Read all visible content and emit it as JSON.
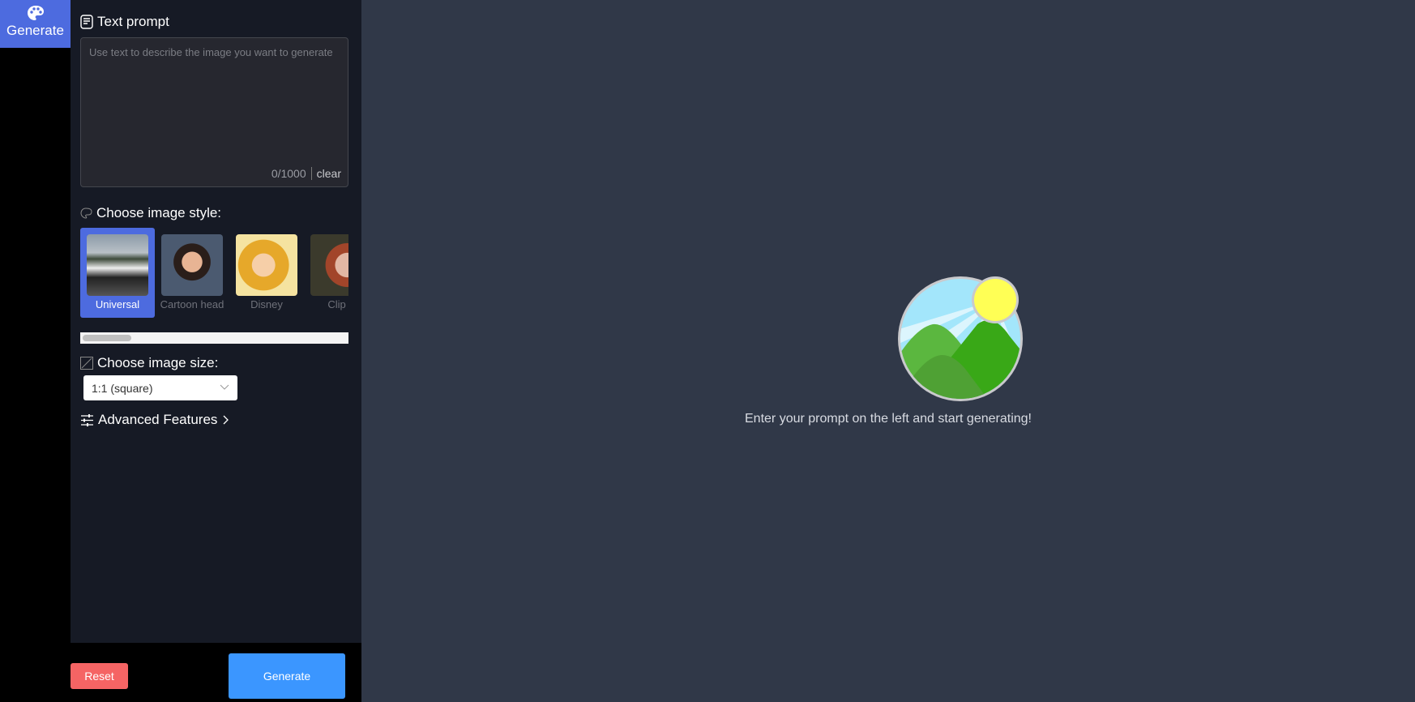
{
  "nav": {
    "generate_label": "Generate",
    "icon": "palette-icon"
  },
  "panel": {
    "prompt_title": "Text prompt",
    "prompt_placeholder": "Use text to describe the image you want to generate",
    "prompt_value": "",
    "char_count": "0/1000",
    "clear_label": "clear",
    "style_title": "Choose image style:",
    "styles": [
      {
        "label": "Universal",
        "selected": true
      },
      {
        "label": "Cartoon head"
      },
      {
        "label": "Disney"
      },
      {
        "label": "Clip a"
      }
    ],
    "size_title": "Choose image size:",
    "size_value": "1:1 (square)",
    "advanced_label": "Advanced Features"
  },
  "footer": {
    "reset_label": "Reset",
    "generate_label": "Generate",
    "reset_color": "#f56464",
    "generate_color": "#3b96ff"
  },
  "main": {
    "empty_message": "Enter your prompt on the left and start generating!"
  }
}
